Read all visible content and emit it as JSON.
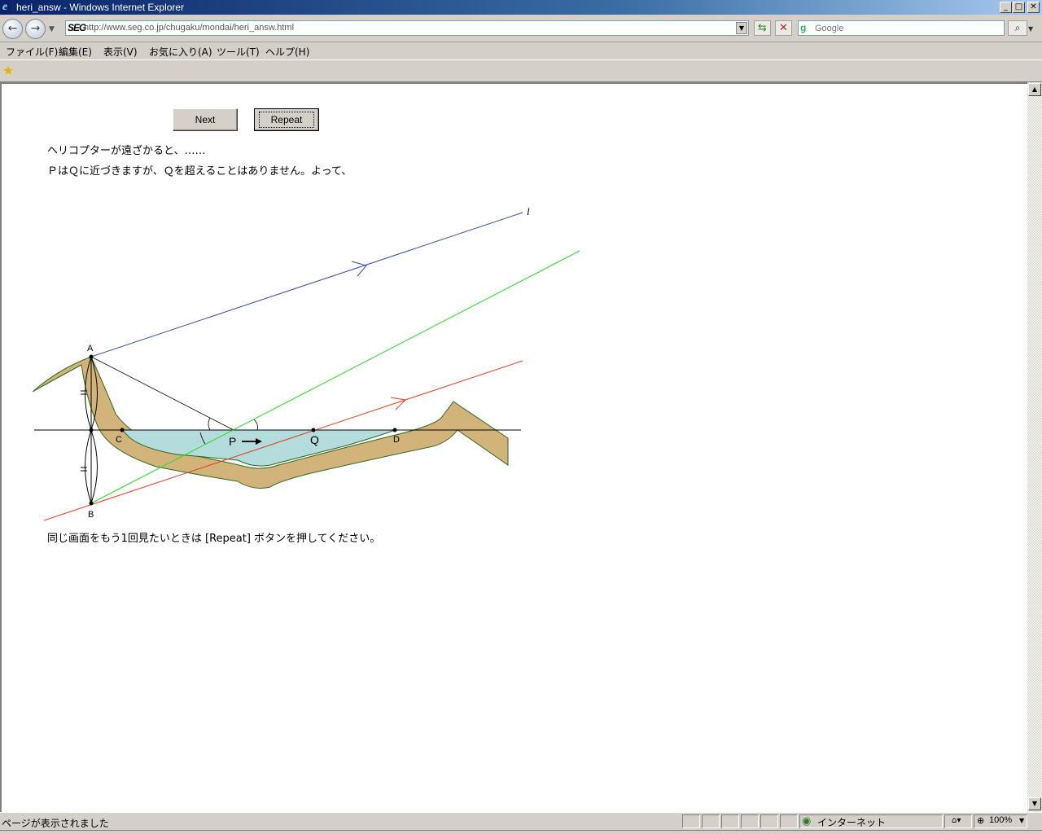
{
  "window": {
    "title": "heri_answ - Windows Internet Explorer",
    "minimize": "_",
    "maximize": "□",
    "close": "✕"
  },
  "address": {
    "logo": "SEG",
    "url": "http://www.seg.co.jp/chugaku/mondai/heri_answ.html"
  },
  "search": {
    "placeholder": "Google",
    "engine_icon": "google-icon"
  },
  "menu": {
    "file": "ファイル(F)",
    "edit": "編集(E)",
    "view": "表示(V)",
    "favorites": "お気に入り(A)",
    "tools": "ツール(T)",
    "help": "ヘルプ(H)"
  },
  "page": {
    "next_label": "Next",
    "repeat_label": "Repeat",
    "line1": "ヘリコプターが遠ざかると、……",
    "line2": "ＰはＱに近づきますが、Ｑを超えることはありません。よって、",
    "footer": "同じ画面をもう1回見たいときは [Repeat] ボタンを押してください。"
  },
  "diagram": {
    "label_A": "A",
    "label_B": "B",
    "label_C": "C",
    "label_D": "D",
    "label_P": "P",
    "label_Q": "Q",
    "label_l": "l",
    "colors": {
      "blue_line": "#3a4aa0",
      "green_line": "#22dd22",
      "red_line": "#e04020",
      "ground": "#d2b47a",
      "ground_edge": "#2a6a20",
      "water": "#b4dcdc"
    }
  },
  "status": {
    "text": "ページが表示されました",
    "zone": "インターネット",
    "zoom": "100%"
  }
}
